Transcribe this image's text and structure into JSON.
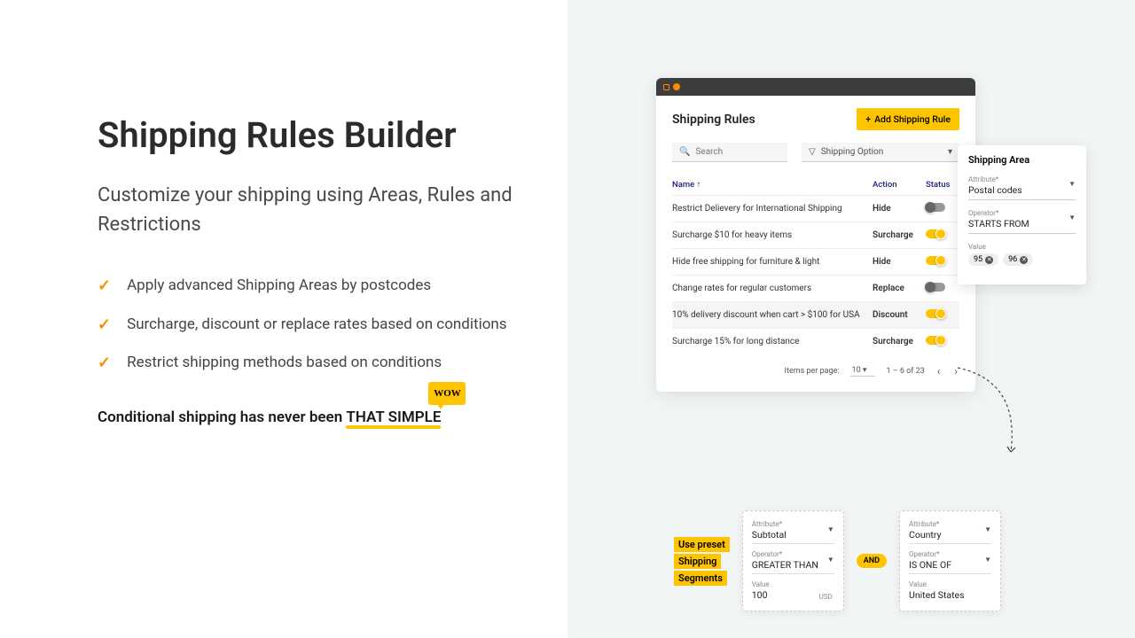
{
  "hero": {
    "title": "Shipping Rules Builder",
    "subtitle": "Customize your shipping using Areas, Rules and Restrictions",
    "bullets": [
      "Apply advanced Shipping Areas by postcodes",
      "Surcharge, discount or replace rates based on conditions",
      "Restrict shipping methods based on conditions"
    ],
    "tagline_pre": "Conditional shipping has never been ",
    "tagline_em": "THAT SIMPLE",
    "wow": "WOW"
  },
  "mock": {
    "title": "Shipping Rules",
    "add_btn": "Add Shipping Rule",
    "search_placeholder": "Search",
    "filter_label": "Shipping Option",
    "headers": {
      "name": "Name",
      "action": "Action",
      "status": "Status"
    },
    "rows": [
      {
        "name": "Restrict Delievery for International Shipping",
        "action": "Hide",
        "on": false
      },
      {
        "name": "Surcharge $10 for heavy items",
        "action": "Surcharge",
        "on": true
      },
      {
        "name": "Hide free shipping for furniture & light",
        "action": "Hide",
        "on": true
      },
      {
        "name": "Change rates for regular customers",
        "action": "Replace",
        "on": false
      },
      {
        "name": "10% delivery discount when cart > $100 for USA",
        "action": "Discount",
        "on": true,
        "selected": true
      },
      {
        "name": "Surcharge 15% for long distance",
        "action": "Surcharge",
        "on": true
      }
    ],
    "pager": {
      "label": "Items per page:",
      "per": "10",
      "range": "1 – 6 of 23"
    }
  },
  "area": {
    "title": "Shipping Area",
    "attr_label": "Attribute*",
    "attr_value": "Postal codes",
    "op_label": "Operator*",
    "op_value": "STARTS FROM",
    "val_label": "Value",
    "chips": [
      "95",
      "96"
    ]
  },
  "segments": {
    "label": [
      "Use preset",
      "Shipping",
      "Segments"
    ],
    "and": "AND",
    "card1": {
      "attr_label": "Attribute*",
      "attr": "Subtotal",
      "op_label": "Operator*",
      "op": "GREATER THAN",
      "val_label": "Value",
      "val": "100",
      "unit": "USD"
    },
    "card2": {
      "attr_label": "Attribute*",
      "attr": "Country",
      "op_label": "Operator*",
      "op": "IS ONE OF",
      "val_label": "Value",
      "val": "United States"
    }
  }
}
